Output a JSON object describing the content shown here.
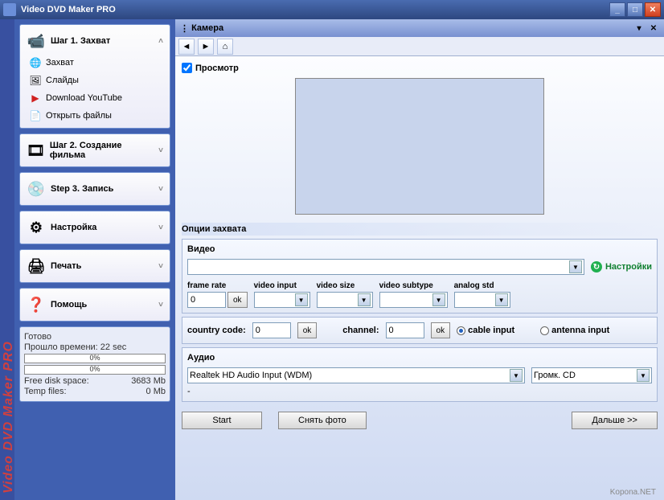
{
  "window": {
    "title": "Video DVD Maker PRO"
  },
  "sidebar": {
    "step1": {
      "title": "Шаг 1. Захват",
      "items": [
        {
          "icon": "🌐",
          "label": "Захват"
        },
        {
          "icon": "🖼",
          "label": "Слайды"
        },
        {
          "icon": "▶",
          "label": "Download YouTube"
        },
        {
          "icon": "📄",
          "label": "Открыть файлы"
        }
      ]
    },
    "step2": {
      "title": "Шаг 2. Создание фильма",
      "icon": "🎞"
    },
    "step3": {
      "title": "Step 3. Запись",
      "icon": "💿"
    },
    "settings": {
      "title": "Настройка",
      "icon": "⚙"
    },
    "print": {
      "title": "Печать",
      "icon": "🖨"
    },
    "help": {
      "title": "Помощь",
      "icon": "❓"
    }
  },
  "status": {
    "ready": "Готово",
    "elapsed_label": "Прошло времени:",
    "elapsed_value": "22 sec",
    "progress1": "0%",
    "progress2": "0%",
    "free_space_label": "Free disk space:",
    "free_space_value": "3683 Mb",
    "temp_label": "Temp files:",
    "temp_value": "0 Mb"
  },
  "panel": {
    "title": "Камера",
    "preview_label": "Просмотр",
    "capture_options": "Опции захвата",
    "video_section": "Видео",
    "settings_link": "Настройки",
    "frame_rate_label": "frame rate",
    "frame_rate_value": "0",
    "ok": "ok",
    "video_input_label": "video input",
    "video_size_label": "video size",
    "video_subtype_label": "video subtype",
    "analog_std_label": "analog std",
    "country_code_label": "country code:",
    "country_code_value": "0",
    "channel_label": "channel:",
    "channel_value": "0",
    "cable_input": "cable input",
    "antenna_input": "antenna input",
    "audio_section": "Аудио",
    "audio_device": "Realtek HD Audio Input (WDM)",
    "audio_line": "Громк. CD",
    "dash": "-",
    "start_btn": "Start",
    "snap_btn": "Снять фото",
    "next_btn": "Дальше >>"
  },
  "vertical_brand": "Video DVD Maker PRO",
  "watermark": "Kopona.NET"
}
